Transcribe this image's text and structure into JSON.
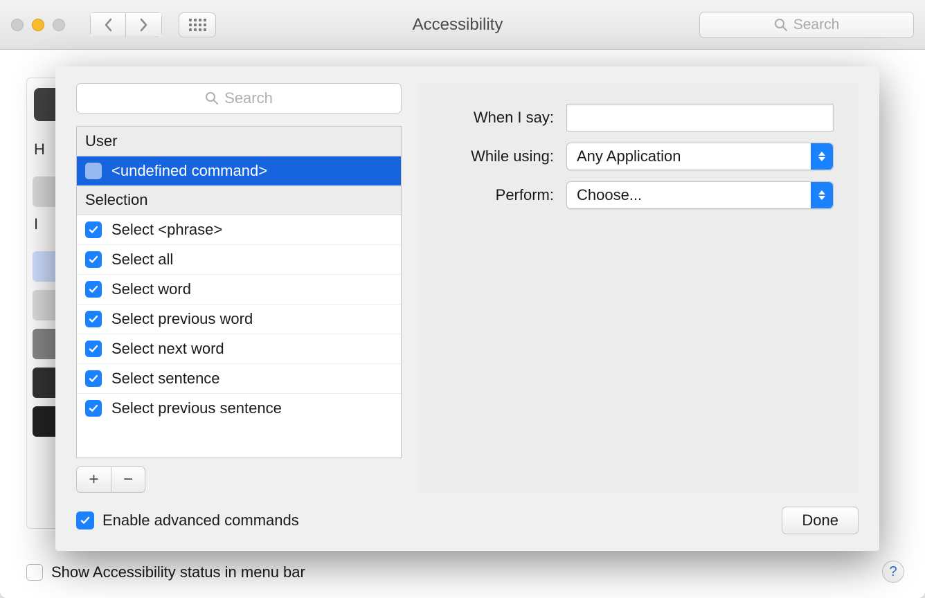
{
  "window": {
    "title": "Accessibility"
  },
  "toolbar": {
    "search_placeholder": "Search"
  },
  "bg": {
    "label1": "H",
    "label2": "I"
  },
  "footer": {
    "status_checkbox_label": "Show Accessibility status in menu bar"
  },
  "sheet": {
    "search_placeholder": "Search",
    "groups": {
      "user": {
        "header": "User",
        "items": [
          {
            "label": "<undefined command>"
          }
        ]
      },
      "selection": {
        "header": "Selection",
        "items": [
          {
            "label": "Select <phrase>"
          },
          {
            "label": "Select all"
          },
          {
            "label": "Select word"
          },
          {
            "label": "Select previous word"
          },
          {
            "label": "Select next word"
          },
          {
            "label": "Select sentence"
          },
          {
            "label": "Select previous sentence"
          }
        ]
      }
    },
    "form": {
      "when_label": "When I say:",
      "when_value": "",
      "while_label": "While using:",
      "while_value": "Any Application",
      "perform_label": "Perform:",
      "perform_value": "Choose..."
    },
    "advanced_label": "Enable advanced commands",
    "done_label": "Done",
    "add_label": "+",
    "remove_label": "−"
  }
}
